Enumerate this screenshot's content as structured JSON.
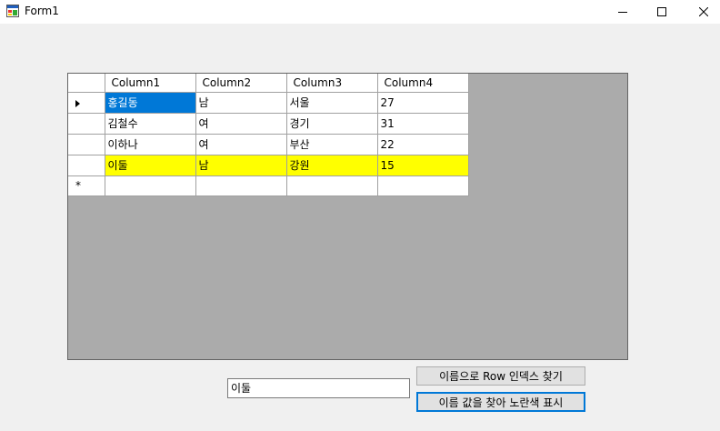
{
  "window": {
    "title": "Form1",
    "minimize_icon": "minimize-icon",
    "maximize_icon": "maximize-icon",
    "close_icon": "close-icon"
  },
  "grid": {
    "columns": [
      "Column1",
      "Column2",
      "Column3",
      "Column4"
    ],
    "rows": [
      [
        "홍길동",
        "남",
        "서울",
        "27"
      ],
      [
        "김철수",
        "여",
        "경기",
        "31"
      ],
      [
        "이하나",
        "여",
        "부산",
        "22"
      ],
      [
        "이둘",
        "남",
        "강원",
        "15"
      ]
    ],
    "new_row_marker": "*",
    "selected_cell": "홍길동",
    "highlight_color": "#ffff00",
    "selection_color": "#0078d7",
    "background_color": "#ababab"
  },
  "search": {
    "value": "이둘"
  },
  "buttons": {
    "find_row_index": "이름으로 Row 인덱스 찾기",
    "highlight_yellow": "이름 값을 찾아 노란색 표시"
  }
}
